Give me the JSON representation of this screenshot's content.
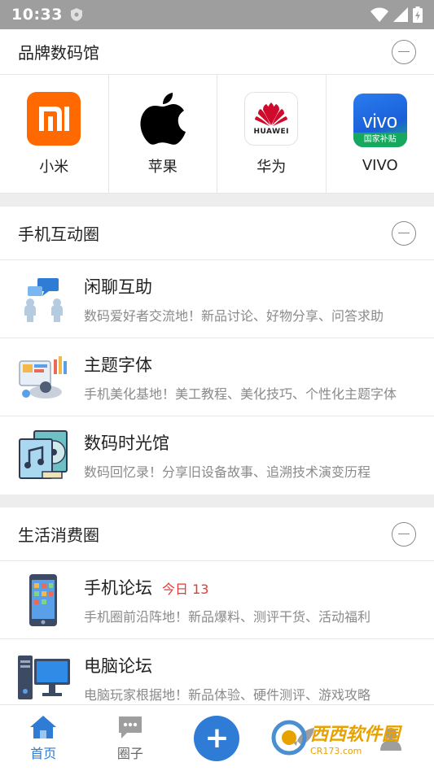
{
  "status_bar": {
    "time": "10:33"
  },
  "brands_section": {
    "title": "品牌数码馆",
    "brands": [
      {
        "name": "小米",
        "logo_text": "mi",
        "color": "#FF6900"
      },
      {
        "name": "苹果",
        "color": "#000000"
      },
      {
        "name": "华为",
        "logo_text": "HUAWEI",
        "color": "#CF0A2C"
      },
      {
        "name": "VIVO",
        "logo_text": "vivo",
        "logo_subtext": "国家补贴",
        "color": "#1e6fe6"
      }
    ]
  },
  "interaction_section": {
    "title": "手机互动圈",
    "items": [
      {
        "title": "闲聊互助",
        "desc": "数码爱好者交流地！新品讨论、好物分享、问答求助",
        "icon": "chat-people-icon"
      },
      {
        "title": "主题字体",
        "desc": "手机美化基地！美工教程、美化技巧、个性化主题字体",
        "icon": "design-palette-icon"
      },
      {
        "title": "数码时光馆",
        "desc": "数码回忆录！分享旧设备故事、追溯技术演变历程",
        "icon": "music-disc-icon"
      }
    ]
  },
  "life_section": {
    "title": "生活消费圈",
    "items": [
      {
        "title": "手机论坛",
        "badge": "今日 13",
        "desc": "手机圈前沿阵地！新品爆料、测评干货、活动福利",
        "icon": "smartphone-icon"
      },
      {
        "title": "电脑论坛",
        "desc": "电脑玩家根据地！新品体验、硬件测评、游戏攻略",
        "icon": "desktop-computer-icon"
      }
    ]
  },
  "bottom_nav": {
    "home": "首页",
    "circle": "圈子",
    "accent_color": "#2f7cd6"
  },
  "watermark": {
    "text": "西西软件园",
    "sub": "CR173.com"
  }
}
